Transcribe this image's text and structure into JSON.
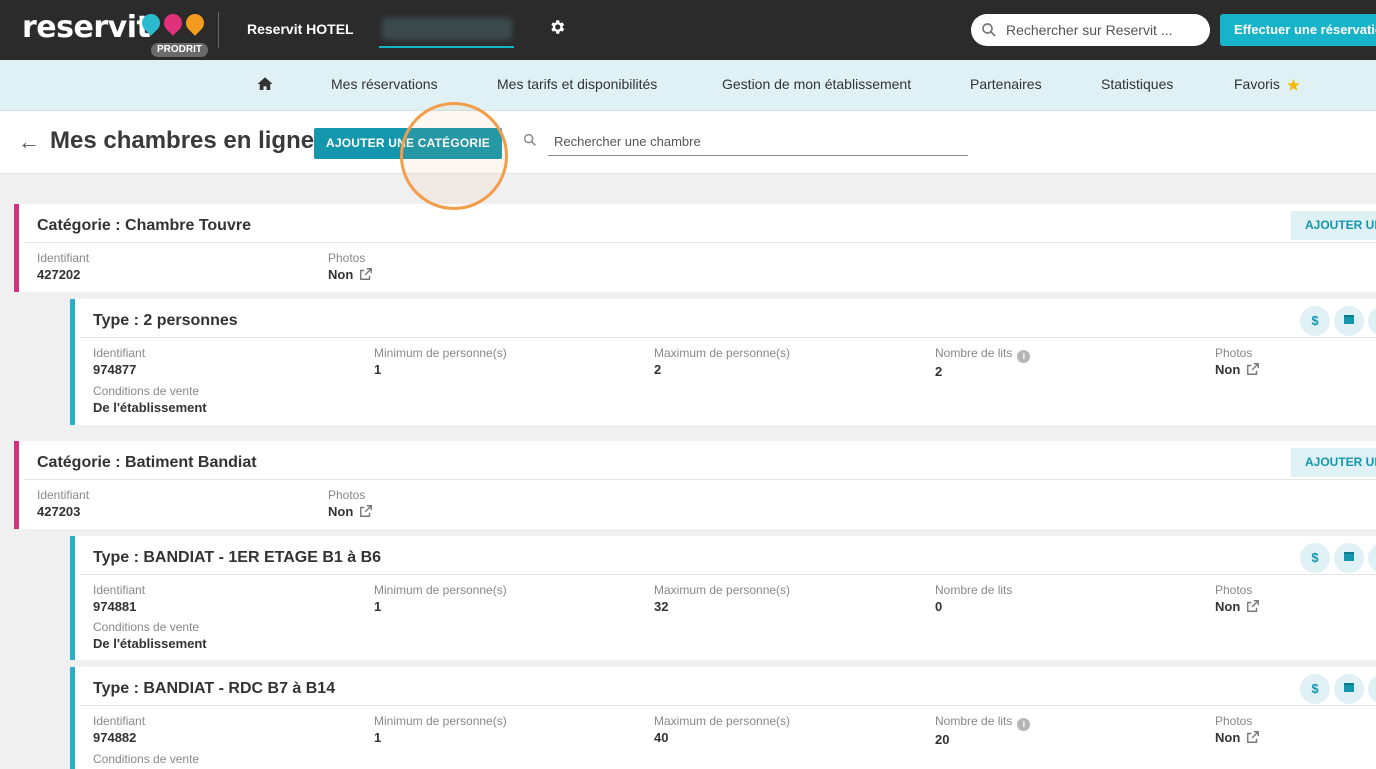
{
  "topbar": {
    "logo": "reservit",
    "logo_badge": "PRODRIT",
    "hotel_name": "Reservit HOTEL",
    "search_placeholder": "Rechercher sur Reservit ...",
    "book_button": "Effectuer une réservation"
  },
  "nav": {
    "items": [
      "Mes réservations",
      "Mes tarifs et disponibilités",
      "Gestion de mon établissement",
      "Partenaires",
      "Statistiques",
      "Favoris"
    ]
  },
  "page": {
    "title": "Mes chambres en ligne",
    "add_category_button": "AJOUTER UNE CATÉGORIE",
    "room_search_placeholder": "Rechercher une chambre"
  },
  "labels": {
    "identifiant": "Identifiant",
    "photos": "Photos",
    "min_persons": "Minimum de personne(s)",
    "max_persons": "Maximum de personne(s)",
    "nb_beds": "Nombre de lits",
    "sale_conditions": "Conditions de vente",
    "add_type_button": "AJOUTER UN"
  },
  "categories": [
    {
      "title": "Catégorie : Chambre Touvre",
      "identifiant": "427202",
      "photos": "Non",
      "types": [
        {
          "title": "Type : 2 personnes",
          "identifiant": "974877",
          "min": "1",
          "max": "2",
          "beds": "2",
          "photos": "Non",
          "conditions": "De l'établissement"
        }
      ]
    },
    {
      "title": "Catégorie : Batiment Bandiat",
      "identifiant": "427203",
      "photos": "Non",
      "types": [
        {
          "title": "Type : BANDIAT - 1ER ETAGE B1 à B6",
          "identifiant": "974881",
          "min": "1",
          "max": "32",
          "beds": "0",
          "photos": "Non",
          "conditions": "De l'établissement"
        },
        {
          "title": "Type : BANDIAT - RDC B7 à B14",
          "identifiant": "974882",
          "min": "1",
          "max": "40",
          "beds": "20",
          "photos": "Non",
          "conditions": ""
        }
      ]
    }
  ],
  "colors": {
    "topbar": "#2b2b2b",
    "accent": "#17b3c8",
    "category_border": "#d4327a",
    "type_border": "#28b1c9",
    "highlight": "#f39c4a"
  }
}
